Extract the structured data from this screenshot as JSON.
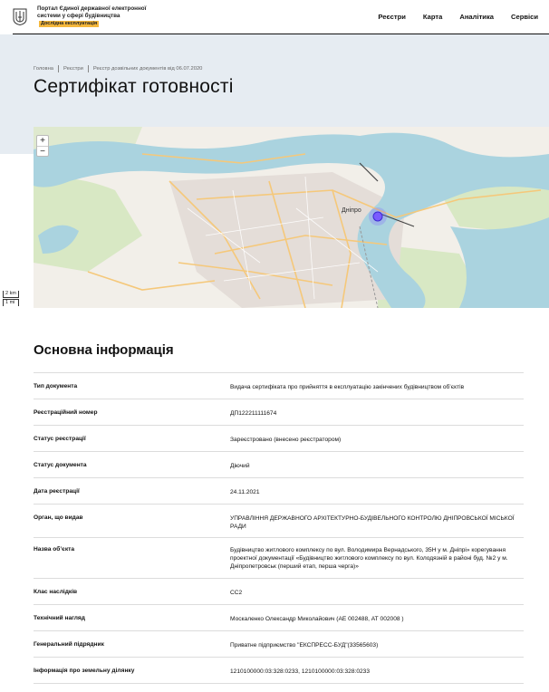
{
  "header": {
    "portal_title": "Портал Єдиної державної електронної системи у сфері будівництва",
    "beta_label": "Дослідна експлуатація",
    "nav": [
      "Реєстри",
      "Карта",
      "Аналітика",
      "Сервіси"
    ]
  },
  "breadcrumb": [
    "Головна",
    "Реєстри",
    "Реєстр дозвільних документів від 06.07.2020"
  ],
  "page_title": "Сертифікат готовності",
  "map": {
    "zoom_in": "+",
    "zoom_out": "−",
    "city_label": "Дніпро",
    "scale_km": "2 km",
    "scale_mi": "1 mi",
    "colors": {
      "water": "#aad3df",
      "land": "#f2efe9",
      "green": "#c8dfb0",
      "road": "#f5c87a",
      "marker": "#7a5cff"
    }
  },
  "section_title": "Основна інформація",
  "rows": [
    {
      "label": "Тип документа",
      "value": "Видача сертифіката про прийняття в експлуатацію закінчених будівництвом об’єктів"
    },
    {
      "label": "Реєстраційний номер",
      "value": "ДП122211111674"
    },
    {
      "label": "Статус реєстрації",
      "value": "Зареєстровано (внесено реєстратором)"
    },
    {
      "label": "Статус документа",
      "value": "Діючий"
    },
    {
      "label": "Дата реєстрації",
      "value": "24.11.2021"
    },
    {
      "label": "Орган, що видав",
      "value": "УПРАВЛІННЯ ДЕРЖАВНОГО АРХІТЕКТУРНО-БУДІВЕЛЬНОГО КОНТРОЛЮ ДНІПРОВСЬКОЇ МІСЬКОЇ РАДИ"
    },
    {
      "label": "Назва об’єкта",
      "value": "Будівництво житлового комплексу по вул. Володимира Вернадського, 35Н у м. Дніпрі» корегування проектної документації «Будівництво житлового комплексу по вул. Колодязній в районі буд. №2 у м. Дніпропетровськ (перший етап, перша черга)»"
    },
    {
      "label": "Клас наслідків",
      "value": "СС2"
    },
    {
      "label": "Технічний нагляд",
      "value": "Москаленко Олександр Миколайович (АЕ 002488, АТ 002008 )"
    },
    {
      "label": "Генеральний підрядник",
      "value": "Приватне підприємство \"ЕКСПРЕСС-БУД\"(33565603)"
    },
    {
      "label": "Інформація про земельну ділянку",
      "value": "1210100000:03:328:0233, 1210100000:03:328:0233"
    }
  ]
}
